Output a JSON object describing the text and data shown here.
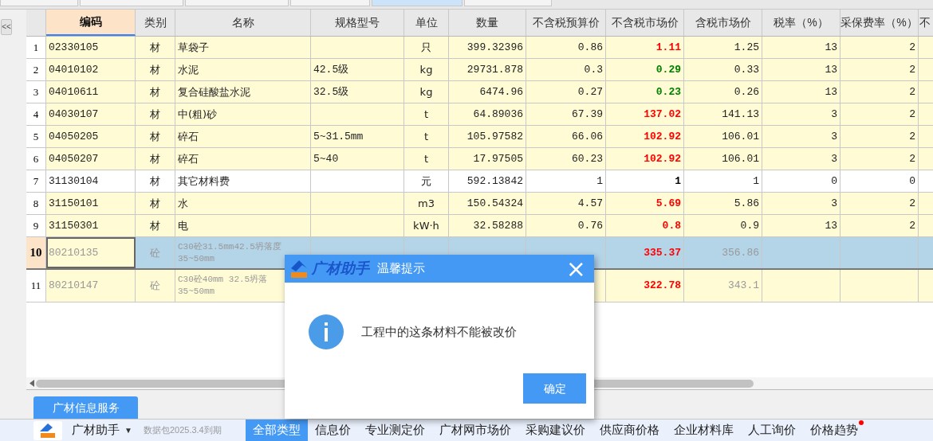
{
  "top_tabs": [
    {
      "selected": false
    },
    {
      "selected": false
    },
    {
      "selected": false
    },
    {
      "selected": false
    },
    {
      "selected": true
    },
    {
      "selected": false
    }
  ],
  "sidebar": {
    "collapse_button": "<<"
  },
  "table": {
    "columns": [
      {
        "label": "编码",
        "selected": true
      },
      {
        "label": "类别",
        "selected": false
      },
      {
        "label": "名称",
        "selected": false
      },
      {
        "label": "规格型号",
        "selected": false
      },
      {
        "label": "单位",
        "selected": false
      },
      {
        "label": "数量",
        "selected": false
      },
      {
        "label": "不含税预算价",
        "selected": false
      },
      {
        "label": "不含税市场价",
        "selected": false
      },
      {
        "label": "含税市场价",
        "selected": false
      },
      {
        "label": "税率（%）",
        "selected": false
      },
      {
        "label": "采保费率（%）",
        "selected": false
      },
      {
        "label": "不",
        "selected": false
      }
    ],
    "rows": [
      {
        "num": "1",
        "code": "02330105",
        "type": "材",
        "name": "草袋子",
        "spec": "",
        "unit": "只",
        "qty": "399.32396",
        "budget": "0.86",
        "market": "1.11",
        "color": "#ff0000",
        "taxed": "1.25",
        "tax_rate": "13",
        "fee_rate": "2",
        "highlighted": true,
        "selected": false,
        "disabled": false
      },
      {
        "num": "2",
        "code": "04010102",
        "type": "材",
        "name": "水泥",
        "spec": "42.5级",
        "unit": "kg",
        "qty": "29731.878",
        "budget": "0.3",
        "market": "0.29",
        "color": "#008000",
        "taxed": "0.33",
        "tax_rate": "13",
        "fee_rate": "2",
        "highlighted": true,
        "selected": false,
        "disabled": false
      },
      {
        "num": "3",
        "code": "04010611",
        "type": "材",
        "name": "复合硅酸盐水泥",
        "spec": "32.5级",
        "unit": "kg",
        "qty": "6474.96",
        "budget": "0.27",
        "market": "0.23",
        "color": "#008000",
        "taxed": "0.26",
        "tax_rate": "13",
        "fee_rate": "2",
        "highlighted": true,
        "selected": false,
        "disabled": false
      },
      {
        "num": "4",
        "code": "04030107",
        "type": "材",
        "name": "中(粗)砂",
        "spec": "",
        "unit": "t",
        "qty": "64.89036",
        "budget": "67.39",
        "market": "137.02",
        "color": "#ff0000",
        "taxed": "141.13",
        "tax_rate": "3",
        "fee_rate": "2",
        "highlighted": true,
        "selected": false,
        "disabled": false
      },
      {
        "num": "5",
        "code": "04050205",
        "type": "材",
        "name": "碎石",
        "spec": "5~31.5mm",
        "unit": "t",
        "qty": "105.97582",
        "budget": "66.06",
        "market": "102.92",
        "color": "#ff0000",
        "taxed": "106.01",
        "tax_rate": "3",
        "fee_rate": "2",
        "highlighted": true,
        "selected": false,
        "disabled": false
      },
      {
        "num": "6",
        "code": "04050207",
        "type": "材",
        "name": "碎石",
        "spec": "5~40",
        "unit": "t",
        "qty": "17.97505",
        "budget": "60.23",
        "market": "102.92",
        "color": "#ff0000",
        "taxed": "106.01",
        "tax_rate": "3",
        "fee_rate": "2",
        "highlighted": true,
        "selected": false,
        "disabled": false
      },
      {
        "num": "7",
        "code": "31130104",
        "type": "材",
        "name": "其它材料费",
        "spec": "",
        "unit": "元",
        "qty": "592.13842",
        "budget": "1",
        "market": "1",
        "color": "#000000",
        "taxed": "1",
        "tax_rate": "0",
        "fee_rate": "0",
        "highlighted": false,
        "selected": false,
        "disabled": false
      },
      {
        "num": "8",
        "code": "31150101",
        "type": "材",
        "name": "水",
        "spec": "",
        "unit": "m3",
        "qty": "150.54324",
        "budget": "4.57",
        "market": "5.69",
        "color": "#ff0000",
        "taxed": "5.86",
        "tax_rate": "3",
        "fee_rate": "2",
        "highlighted": true,
        "selected": false,
        "disabled": false
      },
      {
        "num": "9",
        "code": "31150301",
        "type": "材",
        "name": "电",
        "spec": "",
        "unit": "kW·h",
        "qty": "32.58288",
        "budget": "0.76",
        "market": "0.8",
        "color": "#ff0000",
        "taxed": "0.9",
        "tax_rate": "13",
        "fee_rate": "2",
        "highlighted": true,
        "selected": false,
        "disabled": false
      },
      {
        "num": "10",
        "code": "80210135",
        "type": "砼",
        "name": "C30砼31.5mm42.5坍落度",
        "name_line_2": "35~50mm",
        "spec": "",
        "unit": "",
        "qty": "",
        "budget": "",
        "market": "335.37",
        "color": "#ff0000",
        "taxed": "356.86",
        "tax_rate": "",
        "fee_rate": "",
        "highlighted": true,
        "selected": true,
        "disabled": true
      },
      {
        "num": "11",
        "code": "80210147",
        "type": "砼",
        "name": "C30砼40mm 32.5坍落",
        "name_line_2": "35~50mm",
        "spec": "",
        "unit": "",
        "qty": "",
        "budget": "",
        "market": "322.78",
        "color": "#ff0000",
        "taxed": "343.1",
        "tax_rate": "",
        "fee_rate": "",
        "highlighted": true,
        "selected": false,
        "disabled": true
      }
    ]
  },
  "bottom_panel": {
    "tab": "广材信息服务",
    "app_name": "广材助手",
    "dropdown": "▼",
    "expiry": "数据包2025.3.4到期",
    "categories": [
      {
        "label": "全部类型",
        "selected": true,
        "badge": false
      },
      {
        "label": "信息价",
        "selected": false,
        "badge": false
      },
      {
        "label": "专业测定价",
        "selected": false,
        "badge": false
      },
      {
        "label": "广材网市场价",
        "selected": false,
        "badge": false
      },
      {
        "label": "采购建议价",
        "selected": false,
        "badge": false
      },
      {
        "label": "供应商价格",
        "selected": false,
        "badge": false
      },
      {
        "label": "企业材料库",
        "selected": false,
        "badge": false
      },
      {
        "label": "人工询价",
        "selected": false,
        "badge": false
      },
      {
        "label": "价格趋势",
        "selected": false,
        "badge": true
      }
    ]
  },
  "dialog": {
    "brand": "广材助手",
    "title": "温馨提示",
    "close": "×",
    "message": "工程中的这条材料不能被改价",
    "button": "确定"
  }
}
